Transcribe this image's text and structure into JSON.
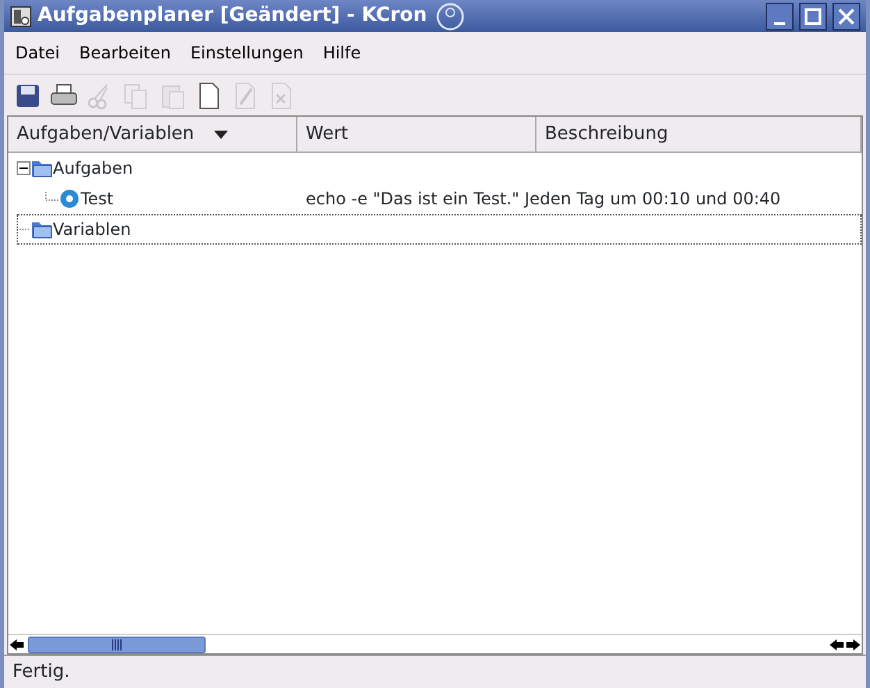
{
  "window": {
    "title": "Aufgabenplaner [Geändert] - KCron"
  },
  "menu": [
    "Datei",
    "Bearbeiten",
    "Einstellungen",
    "Hilfe"
  ],
  "toolbar": [
    {
      "kind": "save",
      "disabled": false
    },
    {
      "kind": "print",
      "disabled": false
    },
    {
      "kind": "cut",
      "disabled": true
    },
    {
      "kind": "copy",
      "disabled": true
    },
    {
      "kind": "paste",
      "disabled": true
    },
    {
      "kind": "new",
      "disabled": false
    },
    {
      "kind": "edit",
      "disabled": true
    },
    {
      "kind": "delete",
      "disabled": true
    }
  ],
  "table": {
    "columns": [
      "Aufgaben/Variablen",
      "Wert",
      "Beschreibung"
    ],
    "rows": [
      {
        "kind": "folder",
        "label": "Aufgaben",
        "expanded": true,
        "selected": false,
        "children": [
          {
            "kind": "task",
            "label": "Test",
            "value": "echo -e \"Das ist ein Test.\" Jeden Tag  um 00:10 und 00:40",
            "selected": false
          }
        ]
      },
      {
        "kind": "folder",
        "label": "Variablen",
        "expanded": false,
        "selected": true
      }
    ]
  },
  "status_bar": "Fertig."
}
